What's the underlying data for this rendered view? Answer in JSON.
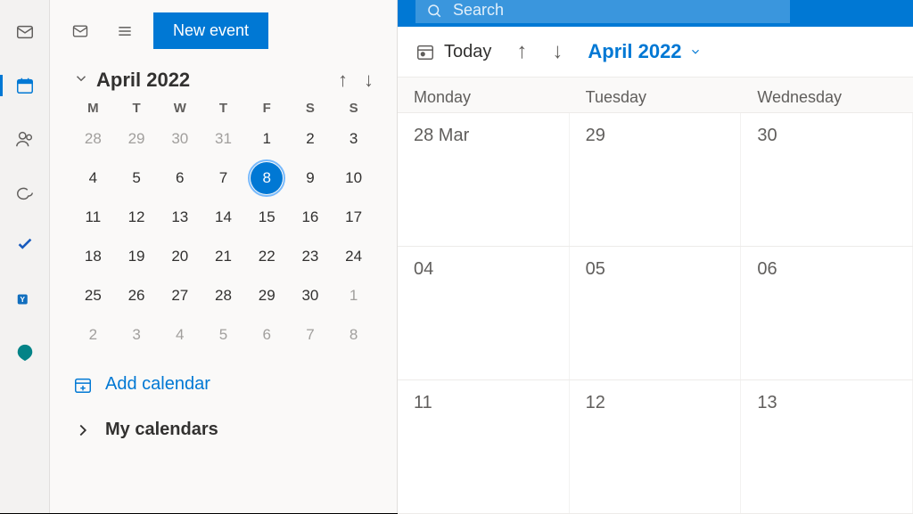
{
  "search": {
    "placeholder": "Search"
  },
  "rail": [
    "mail",
    "calendar",
    "people",
    "files",
    "todo",
    "yammer",
    "bookings"
  ],
  "newEvent": "New event",
  "mini": {
    "month": "April 2022",
    "dow": [
      "M",
      "T",
      "W",
      "T",
      "F",
      "S",
      "S"
    ],
    "today": 8,
    "weeks": [
      [
        {
          "d": 28,
          "dim": true
        },
        {
          "d": 29,
          "dim": true
        },
        {
          "d": 30,
          "dim": true
        },
        {
          "d": 31,
          "dim": true
        },
        {
          "d": 1
        },
        {
          "d": 2
        },
        {
          "d": 3
        }
      ],
      [
        {
          "d": 4
        },
        {
          "d": 5
        },
        {
          "d": 6
        },
        {
          "d": 7
        },
        {
          "d": 8,
          "today": true
        },
        {
          "d": 9
        },
        {
          "d": 10
        }
      ],
      [
        {
          "d": 11
        },
        {
          "d": 12
        },
        {
          "d": 13
        },
        {
          "d": 14
        },
        {
          "d": 15
        },
        {
          "d": 16
        },
        {
          "d": 17
        }
      ],
      [
        {
          "d": 18
        },
        {
          "d": 19
        },
        {
          "d": 20
        },
        {
          "d": 21
        },
        {
          "d": 22
        },
        {
          "d": 23
        },
        {
          "d": 24
        }
      ],
      [
        {
          "d": 25
        },
        {
          "d": 26
        },
        {
          "d": 27
        },
        {
          "d": 28
        },
        {
          "d": 29
        },
        {
          "d": 30
        },
        {
          "d": 1,
          "dim": true
        }
      ],
      [
        {
          "d": 2,
          "dim": true
        },
        {
          "d": 3,
          "dim": true
        },
        {
          "d": 4,
          "dim": true
        },
        {
          "d": 5,
          "dim": true
        },
        {
          "d": 6,
          "dim": true
        },
        {
          "d": 7,
          "dim": true
        },
        {
          "d": 8,
          "dim": true
        }
      ]
    ]
  },
  "addCalendar": "Add calendar",
  "myCalendars": "My calendars",
  "toolbar": {
    "today": "Today",
    "month": "April 2022"
  },
  "weekHeaders": [
    "Monday",
    "Tuesday",
    "Wednesday"
  ],
  "weekRows": [
    [
      "28 Mar",
      "29",
      "30"
    ],
    [
      "04",
      "05",
      "06"
    ],
    [
      "11",
      "12",
      "13"
    ]
  ]
}
